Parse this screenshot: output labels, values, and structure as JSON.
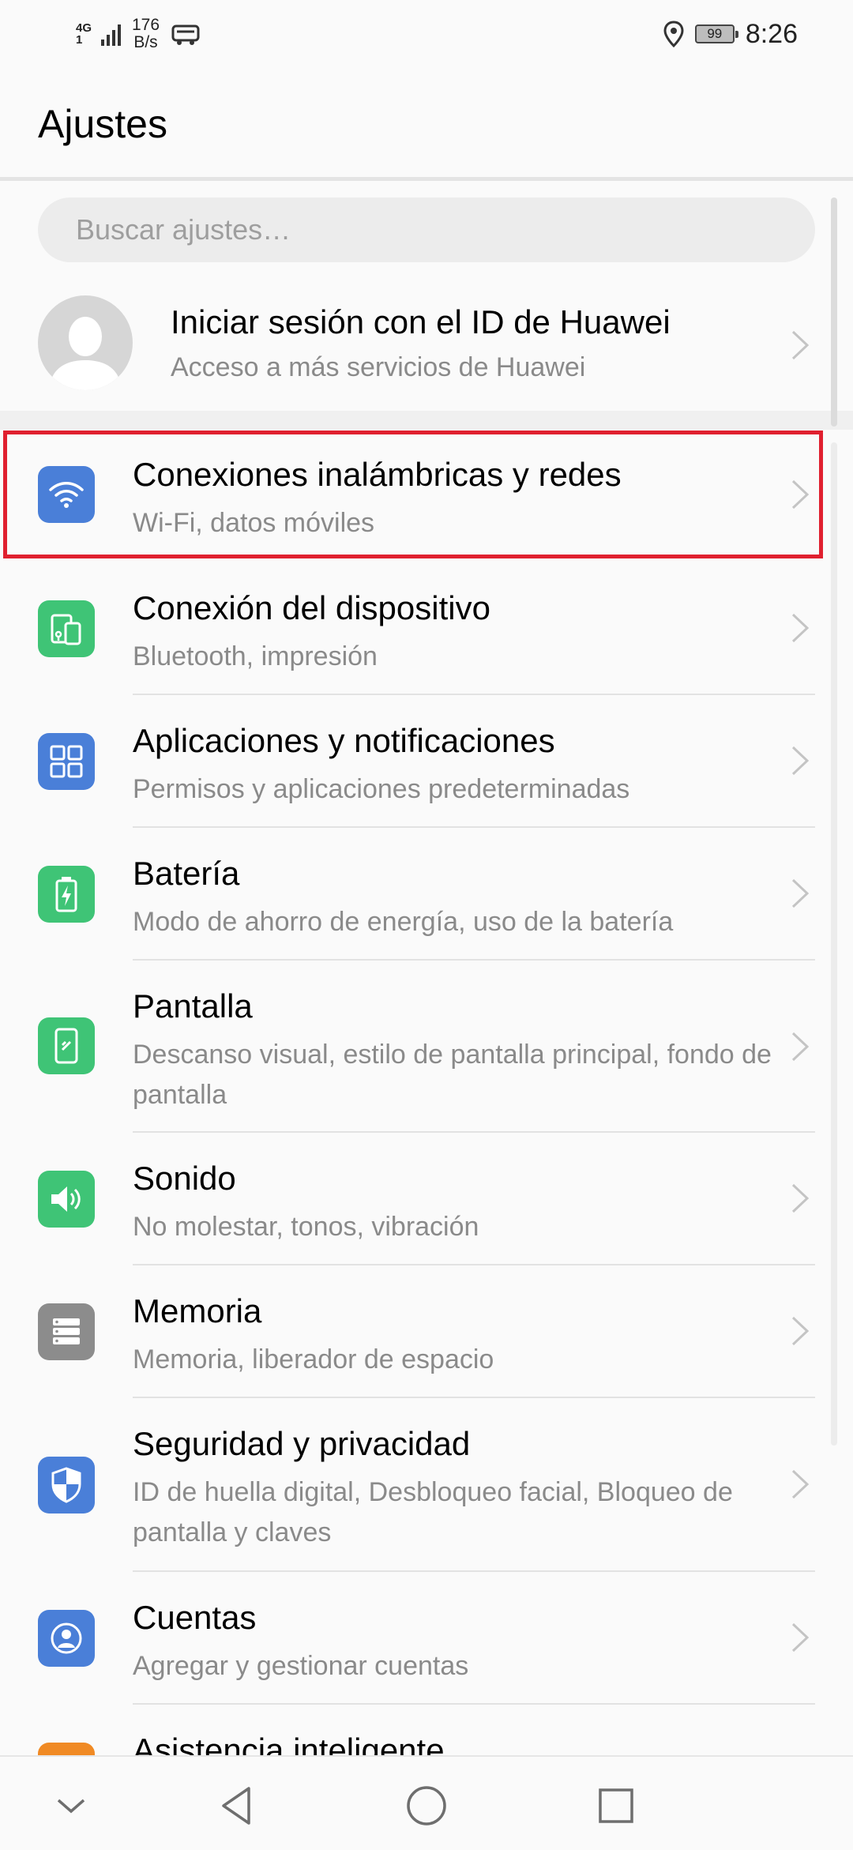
{
  "status_bar": {
    "network_type": "4G",
    "network_sub": "1",
    "speed_value": "176",
    "speed_unit": "B/s",
    "battery_level": "99",
    "time": "8:26"
  },
  "header": {
    "title": "Ajustes"
  },
  "search": {
    "placeholder": "Buscar ajustes…"
  },
  "account": {
    "title": "Iniciar sesión con el ID de Huawei",
    "subtitle": "Acceso a más servicios de Huawei"
  },
  "settings": [
    {
      "title": "Conexiones inalámbricas y redes",
      "subtitle": "Wi-Fi, datos móviles",
      "icon": "wifi-icon",
      "color": "#4a7fd8"
    },
    {
      "title": "Conexión del dispositivo",
      "subtitle": "Bluetooth, impresión",
      "icon": "device-connection-icon",
      "color": "#3fc476"
    },
    {
      "title": "Aplicaciones y notificaciones",
      "subtitle": "Permisos y aplicaciones predeterminadas",
      "icon": "apps-grid-icon",
      "color": "#4a7fd8"
    },
    {
      "title": "Batería",
      "subtitle": "Modo de ahorro de energía, uso de la batería",
      "icon": "battery-icon",
      "color": "#3fc476"
    },
    {
      "title": "Pantalla",
      "subtitle": "Descanso visual, estilo de pantalla principal, fondo de pantalla",
      "icon": "display-icon",
      "color": "#3fc476"
    },
    {
      "title": "Sonido",
      "subtitle": "No molestar, tonos, vibración",
      "icon": "speaker-icon",
      "color": "#3fc476"
    },
    {
      "title": "Memoria",
      "subtitle": "Memoria, liberador de espacio",
      "icon": "storage-icon",
      "color": "#8c8c8c"
    },
    {
      "title": "Seguridad y privacidad",
      "subtitle": "ID de huella digital, Desbloqueo facial, Bloqueo de pantalla y claves",
      "icon": "shield-icon",
      "color": "#4a7fd8"
    },
    {
      "title": "Cuentas",
      "subtitle": "Agregar y gestionar cuentas",
      "icon": "account-icon",
      "color": "#4a7fd8"
    },
    {
      "title": "Asistencia inteligente",
      "subtitle": "",
      "icon": "assistant-icon",
      "color": "#f08a24"
    }
  ],
  "highlight_color": "#e0202f"
}
